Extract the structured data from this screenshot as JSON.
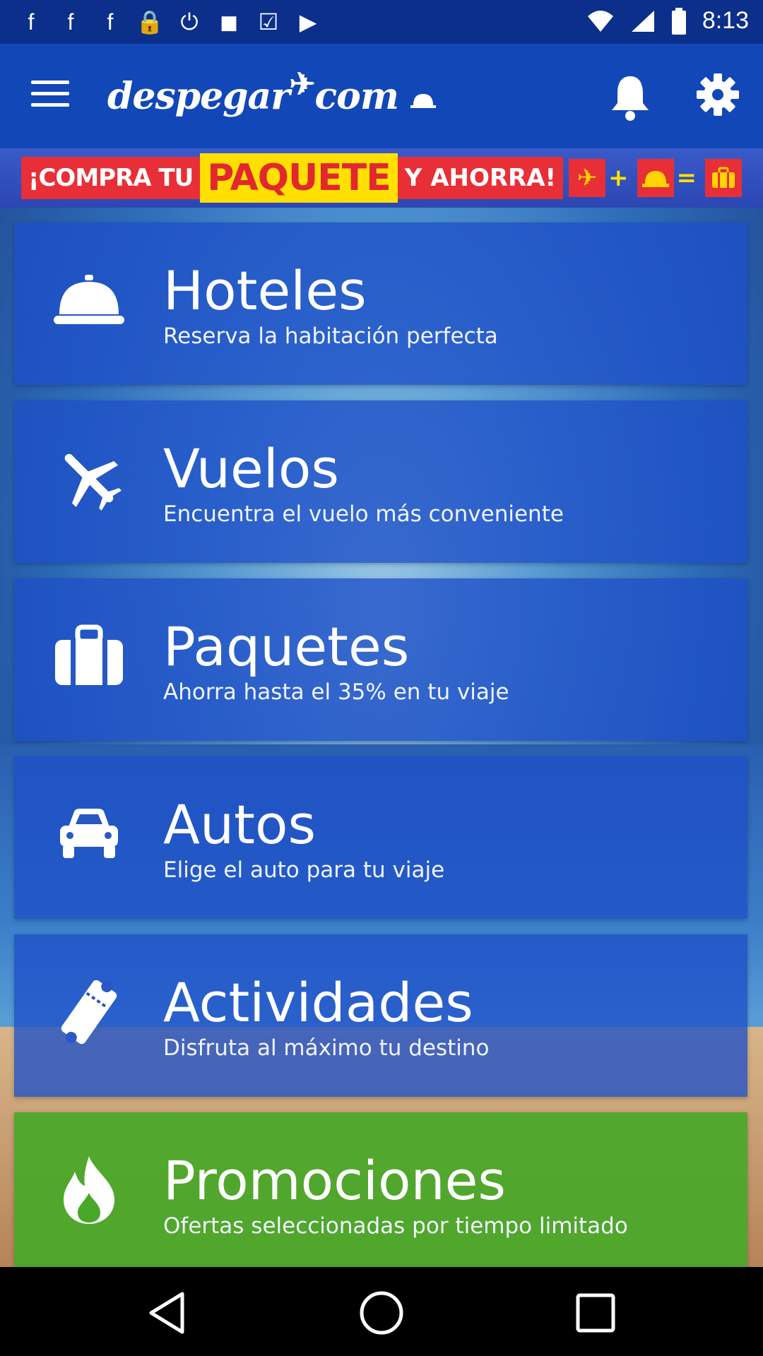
{
  "status_bar": {
    "time": "8:13",
    "left_icons": [
      "facebook-icon",
      "facebook-icon",
      "facebook-icon",
      "lock-icon",
      "alarm-icon",
      "gamepad-icon",
      "check-bag-icon",
      "play-bag-icon"
    ]
  },
  "app_bar": {
    "logo_text": "despegar",
    "logo_suffix": "com"
  },
  "promo_banner": {
    "part1": "¡COMPRA TU",
    "part2": "PAQUETE",
    "part3": "Y AHORRA!",
    "plus": "+",
    "equals": "="
  },
  "menu": [
    {
      "title": "Hoteles",
      "subtitle": "Reserva la habitación perfecta",
      "icon": "hotel-bell-icon"
    },
    {
      "title": "Vuelos",
      "subtitle": "Encuentra el vuelo más conveniente",
      "icon": "airplane-icon"
    },
    {
      "title": "Paquetes",
      "subtitle": "Ahorra hasta el 35% en tu viaje",
      "icon": "suitcase-icon"
    },
    {
      "title": "Autos",
      "subtitle": "Elige el auto para tu viaje",
      "icon": "car-icon"
    },
    {
      "title": "Actividades",
      "subtitle": "Disfruta al máximo tu destino",
      "icon": "ticket-icon"
    },
    {
      "title": "Promociones",
      "subtitle": "Ofertas seleccionadas por tiempo limitado",
      "icon": "flame-icon"
    }
  ],
  "colors": {
    "app_bar": "#1247b8",
    "status_bar": "#0b2f8a",
    "card_blue": "#1e50c8",
    "card_green": "#48a828",
    "promo_red": "#e82f37",
    "promo_yellow": "#ffe000"
  }
}
